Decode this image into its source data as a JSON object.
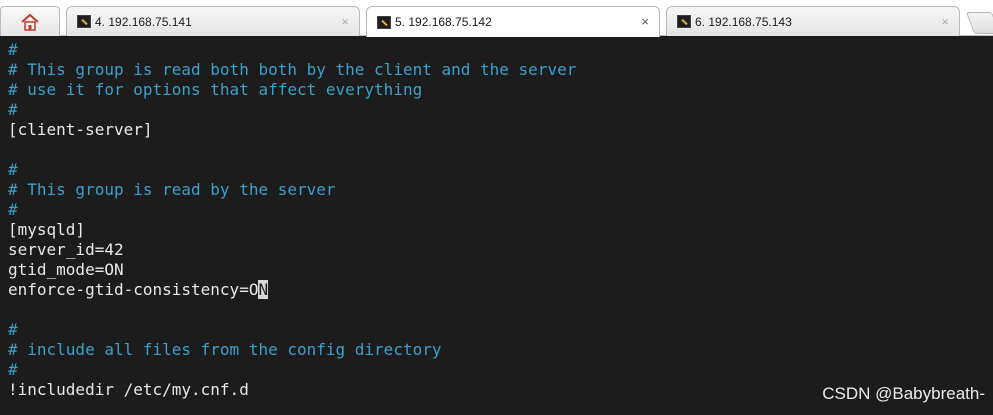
{
  "tabs": [
    {
      "label": "4. 192.168.75.141",
      "active": false
    },
    {
      "label": "5. 192.168.75.142",
      "active": true
    },
    {
      "label": "6. 192.168.75.143",
      "active": false
    }
  ],
  "tab_close_glyph": "×",
  "home_icon": "home-icon",
  "terminal": {
    "colors": {
      "background": "#1c1c1c",
      "comment": "#3aa0c8",
      "text": "#e8e8e8"
    },
    "lines": [
      {
        "text": "#",
        "style": "comment"
      },
      {
        "text": "# This group is read both both by the client and the server",
        "style": "comment"
      },
      {
        "text": "# use it for options that affect everything",
        "style": "comment"
      },
      {
        "text": "#",
        "style": "comment"
      },
      {
        "text": "[client-server]",
        "style": "text"
      },
      {
        "text": "",
        "style": "text"
      },
      {
        "text": "#",
        "style": "comment"
      },
      {
        "text": "# This group is read by the server",
        "style": "comment"
      },
      {
        "text": "#",
        "style": "comment"
      },
      {
        "text": "[mysqld]",
        "style": "text"
      },
      {
        "text": "server_id=42",
        "style": "text"
      },
      {
        "text": "gtid_mode=ON",
        "style": "text"
      },
      {
        "text_before_cursor": "enforce-gtid-consistency=O",
        "cursor_char": "N",
        "style": "text"
      },
      {
        "text": "",
        "style": "text"
      },
      {
        "text": "#",
        "style": "comment"
      },
      {
        "text": "# include all files from the config directory",
        "style": "comment"
      },
      {
        "text": "#",
        "style": "comment"
      },
      {
        "text": "!includedir /etc/my.cnf.d",
        "style": "text"
      }
    ]
  },
  "watermark": "CSDN @Babybreath-"
}
